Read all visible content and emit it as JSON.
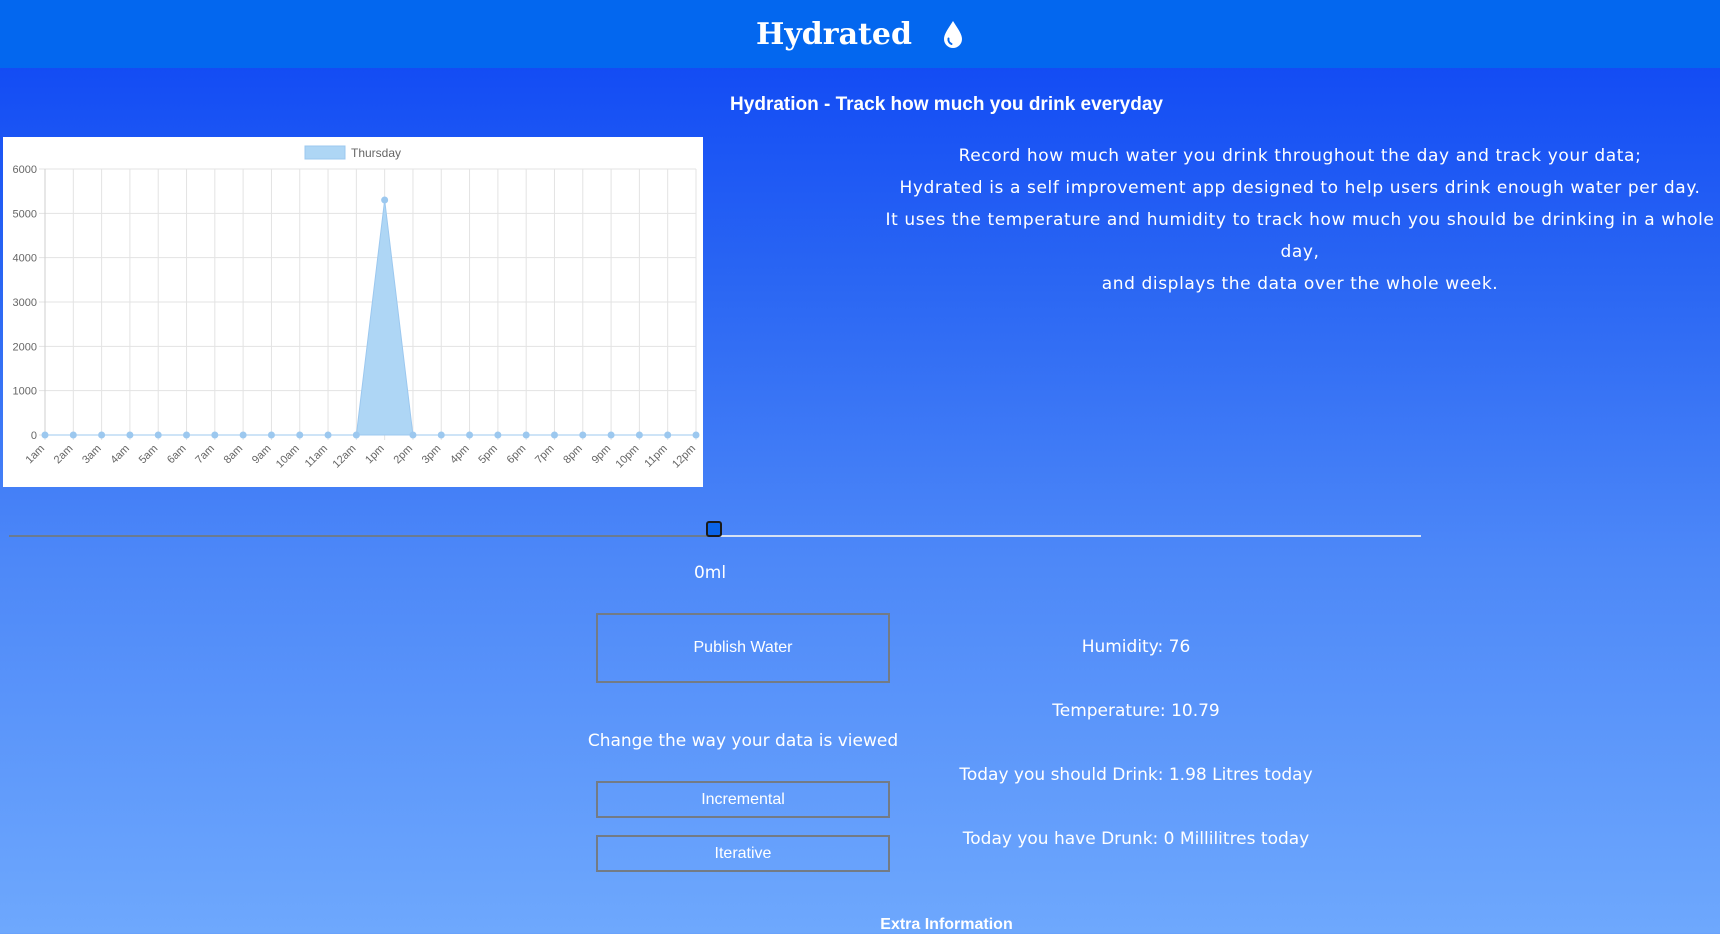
{
  "header": {
    "title": "Hydrated",
    "icon": "water-drop-icon"
  },
  "subtitle": "Hydration - Track how much you drink everyday",
  "description": [
    "Record how much water you drink throughout the day and track your data;",
    "Hydrated is a self improvement app designed to help users drink enough water per day.",
    "It uses the temperature and humidity to track how much you should be drinking in a whole day,",
    "and displays the data over the whole week."
  ],
  "slider": {
    "value_label": "0ml"
  },
  "buttons": {
    "publish": "Publish Water",
    "incremental": "Incremental",
    "iterative": "Iterative"
  },
  "change_label": "Change the way your data is viewed",
  "info": {
    "humidity": "Humidity: 76",
    "temperature": "Temperature: 10.79",
    "should_drink": "Today you should Drink: 1.98 Litres today",
    "have_drunk": "Today you have Drunk: 0 Millilitres today"
  },
  "extra_label": "Extra Information",
  "chart_data": {
    "type": "area",
    "legend": [
      "Thursday"
    ],
    "legend_position": "top",
    "categories": [
      "1am",
      "2am",
      "3am",
      "4am",
      "5am",
      "6am",
      "7am",
      "8am",
      "9am",
      "10am",
      "11am",
      "12am",
      "1pm",
      "2pm",
      "3pm",
      "4pm",
      "5pm",
      "6pm",
      "7pm",
      "8pm",
      "9pm",
      "10pm",
      "11pm",
      "12pm"
    ],
    "series": [
      {
        "name": "Thursday",
        "values": [
          0,
          0,
          0,
          0,
          0,
          0,
          0,
          0,
          0,
          0,
          0,
          0,
          5300,
          0,
          0,
          0,
          0,
          0,
          0,
          0,
          0,
          0,
          0,
          0
        ]
      }
    ],
    "ylim": [
      0,
      6000
    ],
    "yticks": [
      0,
      1000,
      2000,
      3000,
      4000,
      5000,
      6000
    ],
    "grid": true,
    "colors": {
      "fill": "#aed6f5",
      "line": "#9cc8ef",
      "point": "#9cc8ef"
    }
  }
}
